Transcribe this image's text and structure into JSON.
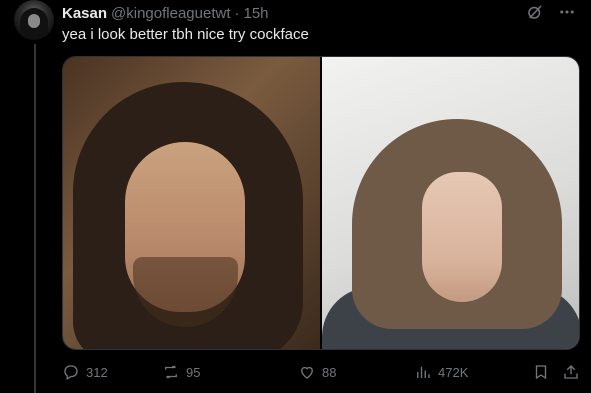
{
  "tweet": {
    "display_name": "Kasan",
    "handle": "@kingofleaguetwt",
    "separator": "·",
    "time": "15h",
    "text": "yea i look better tbh nice try cockface"
  },
  "actions": {
    "replies": "312",
    "retweets": "95",
    "likes": "88",
    "views": "472K"
  },
  "icons": {
    "grok": "grok-icon",
    "more": "more-icon",
    "reply": "reply-icon",
    "retweet": "retweet-icon",
    "like": "heart-icon",
    "views": "views-icon",
    "bookmark": "bookmark-icon",
    "share": "share-icon"
  },
  "colors": {
    "background": "#000000",
    "text": "#e7e9ea",
    "muted": "#71767b",
    "border": "#2f3336"
  }
}
